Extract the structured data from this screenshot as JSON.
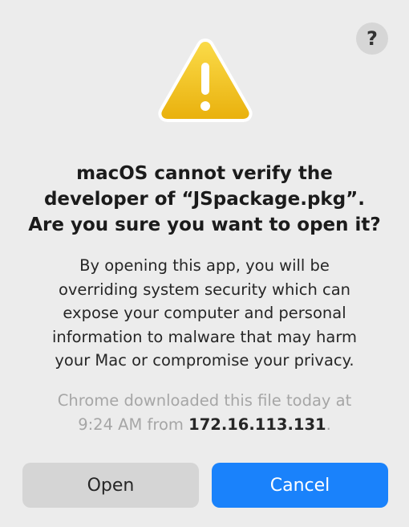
{
  "help": {
    "label": "?"
  },
  "icon": {
    "name": "warning-icon",
    "glyph": "!"
  },
  "title": {
    "lines": [
      "macOS cannot verify the",
      "developer of “JSpackage.pkg”.",
      "Are you sure you want to open it?"
    ]
  },
  "body": {
    "lines": [
      "By opening this app, you will be",
      "overriding system security which can",
      "expose your computer and personal",
      "information to malware that may harm",
      "your Mac or compromise your privacy."
    ]
  },
  "source": {
    "line1": "Chrome downloaded this file today at",
    "line2_prefix": "9:24 AM from ",
    "ip": "172.16.113.131",
    "line2_suffix": "."
  },
  "buttons": {
    "open_label": "Open",
    "cancel_label": "Cancel"
  },
  "colors": {
    "background": "#ececec",
    "primary": "#1a82fb",
    "secondary_button": "#d5d5d5",
    "warning_yellow": "#f3c316",
    "muted_text": "#a6a6a6"
  }
}
